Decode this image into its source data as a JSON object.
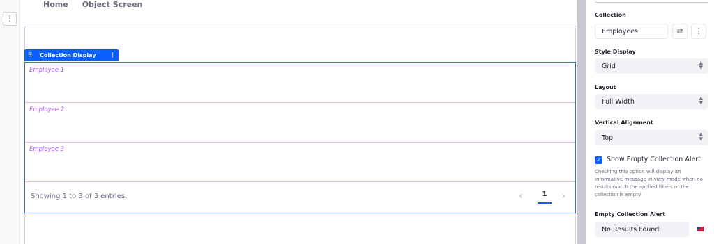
{
  "breadcrumb": {
    "home": "Home",
    "object_screen": "Object Screen"
  },
  "rail": {
    "options_icon": "⋮"
  },
  "fragment": {
    "title": "Collection Display",
    "items": [
      "Employee 1",
      "Employee 2",
      "Employee 3"
    ],
    "pagination": {
      "summary": "Showing 1 to 3 of 3 entries.",
      "current_page": "1",
      "prev": "‹",
      "next": "›"
    }
  },
  "panel": {
    "collection": {
      "label": "Collection",
      "value": "Employees"
    },
    "style_display": {
      "label": "Style Display",
      "value": "Grid"
    },
    "layout": {
      "label": "Layout",
      "value": "Full Width"
    },
    "vertical_alignment": {
      "label": "Vertical Alignment",
      "value": "Top"
    },
    "show_empty_alert": {
      "label": "Show Empty Collection Alert",
      "checked": true,
      "help": "Checking this option will display an informative message in view mode when no results match the applied filters or the collection is empty."
    },
    "empty_alert": {
      "label": "Empty Collection Alert",
      "value": "No Results Found"
    }
  },
  "colors": {
    "accent": "#0b5fff",
    "item_label": "#a855f7",
    "item_divider": "#e7b6f0"
  },
  "icons": [
    "options-icon",
    "drag-handle-icon",
    "kebab-icon",
    "change-icon",
    "caret-updown-icon",
    "check-icon",
    "us-flag-icon",
    "chevron-left-icon",
    "chevron-right-icon"
  ]
}
